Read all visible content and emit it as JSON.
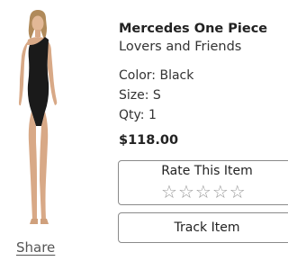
{
  "product": {
    "title": "Mercedes One Piece",
    "brand": "Lovers and Friends",
    "color": "Color: Black",
    "size": "Size: S",
    "qty": "Qty: 1",
    "price": "$118.00",
    "image_icon": "model-in-black-swimsuit"
  },
  "actions": {
    "share": "Share",
    "rate": "Rate This Item",
    "track": "Track Item",
    "stars": [
      "☆",
      "☆",
      "☆",
      "☆",
      "☆"
    ]
  },
  "colors": {
    "text": "#222222",
    "border": "#8a8a8a",
    "star": "#9a9a9a",
    "swimsuit": "#1a1a1a"
  }
}
